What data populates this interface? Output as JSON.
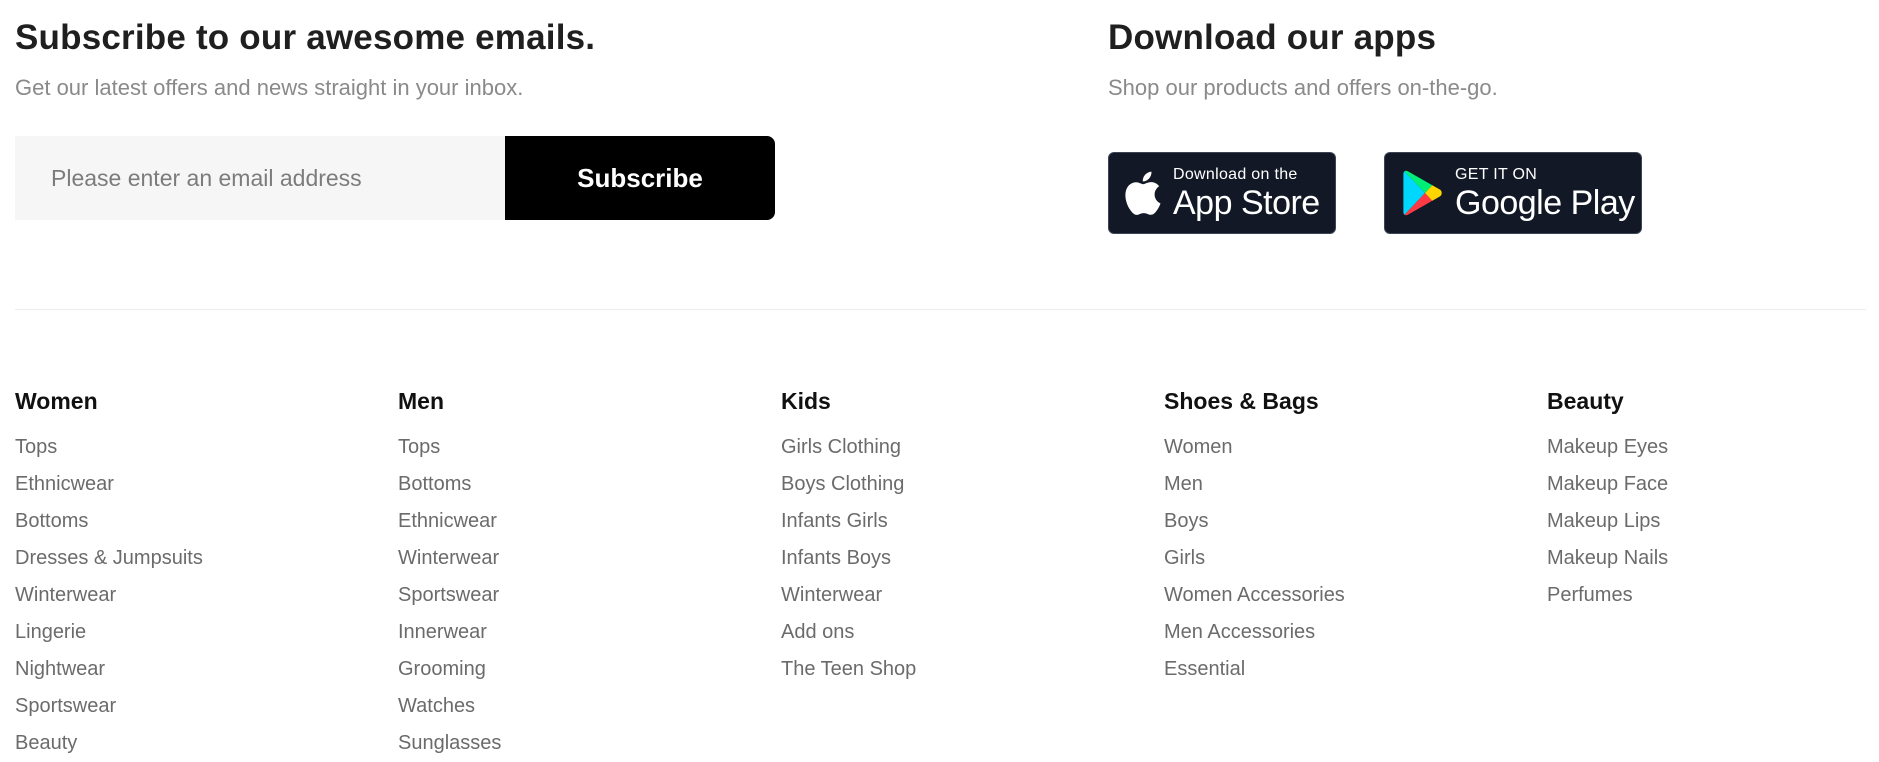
{
  "subscribe": {
    "title": "Subscribe to our awesome emails.",
    "subtitle": "Get our latest offers and news straight in your inbox.",
    "email_placeholder": "Please enter an email address",
    "email_value": "",
    "button_label": "Subscribe"
  },
  "apps": {
    "title": "Download our apps",
    "subtitle": "Shop our products and offers on-the-go.",
    "app_store": {
      "small_text": "Download on the",
      "large_text": "App Store",
      "icon": "apple-icon"
    },
    "google_play": {
      "small_text": "GET IT ON",
      "large_text": "Google Play",
      "icon": "google-play-icon"
    }
  },
  "columns": [
    {
      "title": "Women",
      "links": [
        "Tops",
        "Ethnicwear",
        "Bottoms",
        "Dresses & Jumpsuits",
        "Winterwear",
        "Lingerie",
        "Nightwear",
        "Sportswear",
        "Beauty"
      ]
    },
    {
      "title": "Men",
      "links": [
        "Tops",
        "Bottoms",
        "Ethnicwear",
        "Winterwear",
        "Sportswear",
        "Innerwear",
        "Grooming",
        "Watches",
        "Sunglasses"
      ]
    },
    {
      "title": "Kids",
      "links": [
        "Girls Clothing",
        "Boys Clothing",
        "Infants Girls",
        "Infants Boys",
        "Winterwear",
        "Add ons",
        "The Teen Shop"
      ]
    },
    {
      "title": "Shoes & Bags",
      "links": [
        "Women",
        "Men",
        "Boys",
        "Girls",
        "Women Accessories",
        "Men Accessories",
        "Essential"
      ]
    },
    {
      "title": "Beauty",
      "links": [
        "Makeup Eyes",
        "Makeup Face",
        "Makeup Lips",
        "Makeup Nails",
        "Perfumes"
      ]
    }
  ],
  "colors": {
    "button_bg": "#000000",
    "badge_bg": "#121826",
    "input_bg": "#f6f6f6",
    "link_text": "#6b6b6b",
    "subtitle_text": "#8a8a8a"
  }
}
